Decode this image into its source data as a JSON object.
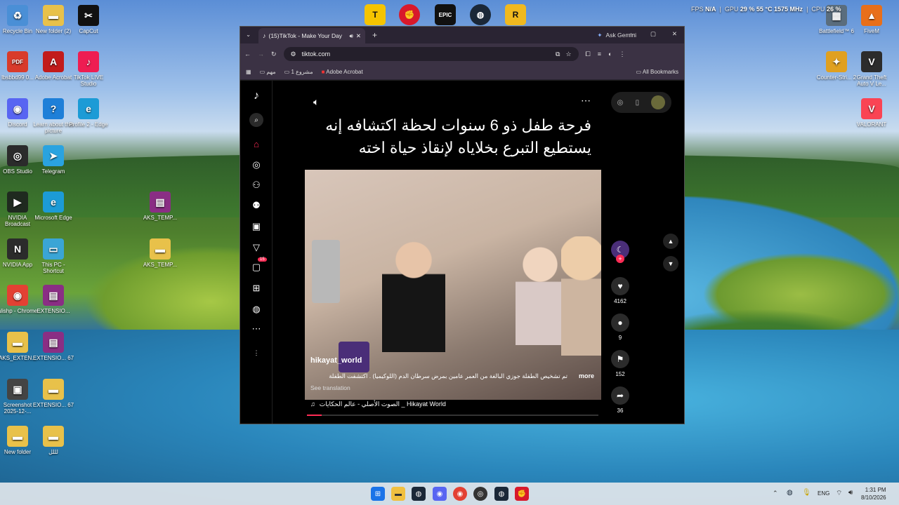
{
  "overlay": {
    "fps_label": "FPS",
    "fps_value": "N/A",
    "gpu_label": "GPU",
    "gpu_stats": "29 % 55 °C 1575 MHz",
    "cpu_label": "CPU",
    "cpu_value": "26 %"
  },
  "desktop_left": [
    {
      "label": "Recycle Bin",
      "icon": "recycle-bin-icon",
      "color": "#4a8fd6",
      "glyph": "♻"
    },
    {
      "label": "New folder (2)",
      "icon": "folder-icon",
      "color": "#e8c14a",
      "glyph": "▬"
    },
    {
      "label": "CapCut",
      "icon": "capcut-icon",
      "color": "#111111",
      "glyph": "✂"
    },
    {
      "label": "lbsbbd99 0...",
      "icon": "pdf-icon",
      "color": "#d83b2b",
      "glyph": "PDF"
    },
    {
      "label": "Adobe Acrobat",
      "icon": "acrobat-icon",
      "color": "#c21b1b",
      "glyph": "A"
    },
    {
      "label": "TikTok LIVE Studio",
      "icon": "tiktok-live-icon",
      "color": "#ee1d52",
      "glyph": "♪"
    },
    {
      "label": "Discord",
      "icon": "discord-icon",
      "color": "#5865f2",
      "glyph": "◉"
    },
    {
      "label": "Learn about this picture",
      "icon": "info-icon",
      "color": "#1e7fd8",
      "glyph": "?"
    },
    {
      "label": "Profile 2 - Edge",
      "icon": "edge-icon",
      "color": "#1c9bd6",
      "glyph": "e"
    },
    {
      "label": "OBS Studio",
      "icon": "obs-icon",
      "color": "#2b2b2b",
      "glyph": "◎"
    },
    {
      "label": "Telegram",
      "icon": "telegram-icon",
      "color": "#2aa3e0",
      "glyph": "➤"
    },
    {
      "label": "NVIDIA Broadcast",
      "icon": "nvidia-broadcast-icon",
      "color": "#1f2a1f",
      "glyph": "▶"
    },
    {
      "label": "Microsoft Edge",
      "icon": "edge-icon",
      "color": "#1c9bd6",
      "glyph": "e"
    },
    {
      "label": "AKS_TEMP...",
      "icon": "winrar-icon",
      "color": "#8a2e84",
      "glyph": "▤"
    },
    {
      "label": "NVIDIA App",
      "icon": "nvidia-icon",
      "color": "#2b2b2b",
      "glyph": "N"
    },
    {
      "label": "This PC - Shortcut",
      "icon": "pc-icon",
      "color": "#3aa5d6",
      "glyph": "▭"
    },
    {
      "label": "AKS_TEMP...",
      "icon": "folder-icon",
      "color": "#e8c14a",
      "glyph": "▬"
    },
    {
      "label": "alishp - Chrome",
      "icon": "chrome-icon",
      "color": "#e34133",
      "glyph": "◉"
    },
    {
      "label": "EXTENSIO...",
      "icon": "winrar-icon",
      "color": "#8a2e84",
      "glyph": "▤"
    },
    {
      "label": "AKS_EXTEN...",
      "icon": "folder-icon",
      "color": "#e8c14a",
      "glyph": "▬"
    },
    {
      "label": "EXTENSIO... 67",
      "icon": "winrar-icon",
      "color": "#8a2e84",
      "glyph": "▤"
    },
    {
      "label": "Screenshot 2025-12-...",
      "icon": "screenshot-icon",
      "color": "#444",
      "glyph": "▣"
    },
    {
      "label": "EXTENSIO... 67",
      "icon": "folder-icon",
      "color": "#e8c14a",
      "glyph": "▬"
    },
    {
      "label": "New folder",
      "icon": "folder-icon",
      "color": "#e8c14a",
      "glyph": "▬"
    },
    {
      "label": "لللل",
      "icon": "folder-icon",
      "color": "#e8c14a",
      "glyph": "▬"
    }
  ],
  "desktop_right": [
    {
      "label": "Battlefield™ 6",
      "icon": "battlefield-icon",
      "color": "#5a6d7d",
      "glyph": "▦"
    },
    {
      "label": "FiveM",
      "icon": "fivem-icon",
      "color": "#e86f1a",
      "glyph": "▲"
    },
    {
      "label": "Counter-Stri... 2",
      "icon": "cs2-icon",
      "color": "#e0a020",
      "glyph": "✦"
    },
    {
      "label": "Grand Theft Auto V Le...",
      "icon": "gta-icon",
      "color": "#2c2c2c",
      "glyph": "V"
    },
    {
      "label": "VALORANT",
      "icon": "valorant-icon",
      "color": "#fa4454",
      "glyph": "V"
    }
  ],
  "browser": {
    "tab_title": "(15)TikTok - Make Your Day",
    "ask_gemini": "Ask Gemini",
    "url": "tiktok.com",
    "bookmarks": [
      "مهم",
      "مشروع 1",
      "Adobe Acrobat"
    ],
    "all_bookmarks": "All Bookmarks"
  },
  "tiktok": {
    "caption_title": "فرحة طفل ذو 6 سنوات لحظة اكتشافه إنه يستطيع التبرع بخلاياه لإنقاذ حياة اخته",
    "username": "hikayat_world",
    "description": "تم تشخيص الطفلة جوزي البالغة من العمر عامين بمرض سرطان الدم (اللوكيميا) . اكتشفت الطفلة",
    "more": "more",
    "see_translation": "See translation",
    "sound": "الصوت الأصلي - عالم الحكايات _ Hikayat World",
    "likes": "4162",
    "comments": "9",
    "saves": "152",
    "shares": "36",
    "inbox_badge": "15"
  },
  "taskbar": {
    "lang": "ENG",
    "time": "1:31 PM",
    "date": "8/10/2026"
  }
}
